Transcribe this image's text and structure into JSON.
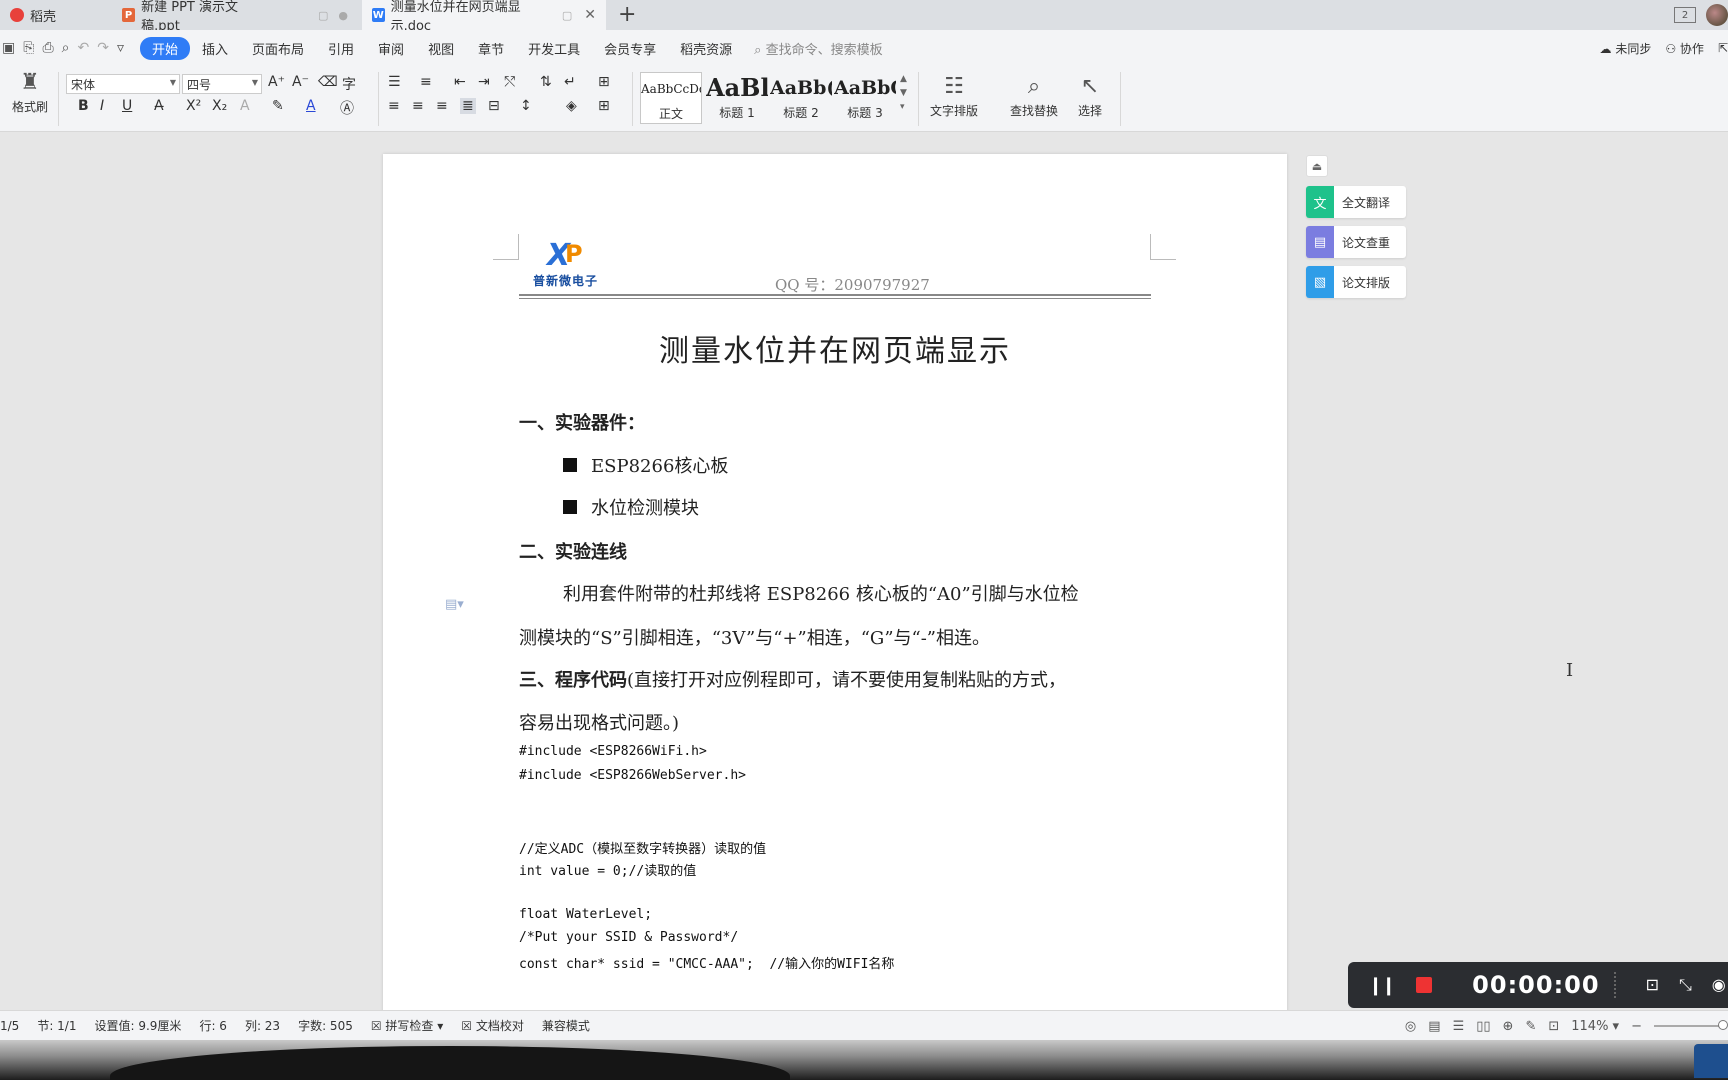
{
  "tabs": [
    {
      "label": "稻壳",
      "icon": "docer-icon",
      "color": "#e8413b"
    },
    {
      "label": "新建 PPT 演示文稿.ppt",
      "icon": "ppt-icon",
      "color": "#e4673a"
    },
    {
      "label": "测量水位并在网页端显示.doc",
      "icon": "word-icon",
      "color": "#2f7cf6"
    }
  ],
  "window_badge": "2",
  "menu": {
    "items": [
      "开始",
      "插入",
      "页面布局",
      "引用",
      "审阅",
      "视图",
      "章节",
      "开发工具",
      "会员专享",
      "稻壳资源"
    ],
    "search_placeholder": "查找命令、搜索模板",
    "sync": "未同步",
    "collab": "协作"
  },
  "toolbar": {
    "format_painter": "格式刷",
    "font_name": "宋体",
    "font_size": "四号",
    "styles": [
      {
        "sample": "AaBbCcDd",
        "label": "正文"
      },
      {
        "sample": "AaBl",
        "label": "标题 1"
      },
      {
        "sample": "AaBb(",
        "label": "标题 2"
      },
      {
        "sample": "AaBbC",
        "label": "标题 3"
      }
    ],
    "text_layout": "文字排版",
    "find_replace": "查找替换",
    "select": "选择"
  },
  "document": {
    "logo_text": "普新微电子",
    "qq": "QQ 号：2090797927",
    "title": "测量水位并在网页端显示",
    "section1": "一、实验器件：",
    "bullets": [
      "ESP8266核心板",
      "水位检测模块"
    ],
    "section2": "二、实验连线",
    "wiring_line1": "利用套件附带的杜邦线将 ESP8266 核心板的“A0”引脚与水位检",
    "wiring_line2": "测模块的“S”引脚相连，“3V”与“+”相连，“G”与“-”相连。",
    "section3_bold": "三、程序代码",
    "section3_note": "(直接打开对应例程即可，请不要使用复制粘贴的方式，",
    "section3_line2": "容易出现格式问题。)",
    "code": [
      "#include <ESP8266WiFi.h>",
      "#include <ESP8266WebServer.h>",
      "//定义ADC（模拟至数字转换器）读取的值",
      "int value = 0;//读取的值",
      "float WaterLevel;",
      "/*Put your SSID & Password*/",
      "const char* ssid = \"CMCC-AAA\";  //输入你的WIFI名称"
    ]
  },
  "side_panel": [
    {
      "label": "全文翻译",
      "color": "#1ec28b"
    },
    {
      "label": "论文查重",
      "color": "#7b7de0"
    },
    {
      "label": "论文排版",
      "color": "#2f9de8"
    }
  ],
  "recorder": {
    "time": "00:00:00"
  },
  "status": {
    "page": "1/5",
    "section": "节: 1/1",
    "setting": "设置值: 9.9厘米",
    "row": "行: 6",
    "col": "列: 23",
    "words": "字数: 505",
    "spell": "拼写检查",
    "proof": "文档校对",
    "compat": "兼容模式",
    "zoom": "114%"
  }
}
